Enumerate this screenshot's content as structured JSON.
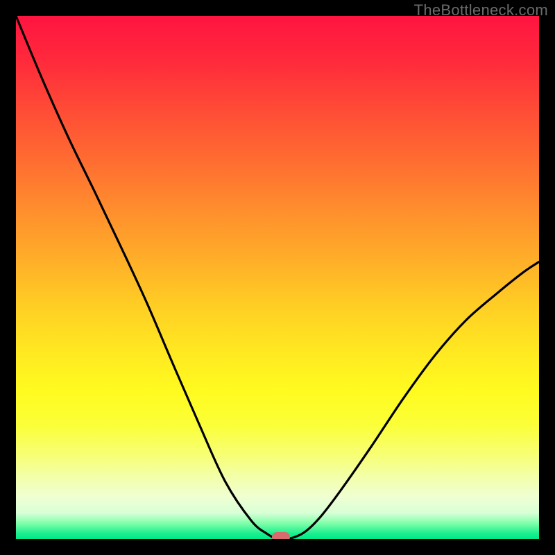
{
  "watermark": "TheBottleneck.com",
  "chart_data": {
    "type": "line",
    "title": "",
    "xlabel": "",
    "ylabel": "",
    "x": [
      0.0,
      0.05,
      0.1,
      0.15,
      0.2,
      0.25,
      0.3,
      0.35,
      0.4,
      0.45,
      0.48,
      0.5,
      0.52,
      0.55,
      0.58,
      0.62,
      0.68,
      0.74,
      0.8,
      0.86,
      0.92,
      0.97,
      1.0
    ],
    "values": [
      1.0,
      0.88,
      0.768,
      0.665,
      0.56,
      0.452,
      0.335,
      0.22,
      0.11,
      0.035,
      0.01,
      0.0,
      0.0,
      0.012,
      0.04,
      0.092,
      0.178,
      0.268,
      0.35,
      0.418,
      0.47,
      0.51,
      0.53
    ],
    "xlim": [
      0,
      1
    ],
    "ylim": [
      0,
      1
    ],
    "marker": {
      "x": 0.506,
      "y": 0.0
    },
    "background_gradient": {
      "type": "vertical",
      "stops": [
        {
          "pos": 0.0,
          "color": "#ff1440"
        },
        {
          "pos": 0.5,
          "color": "#ffb028"
        },
        {
          "pos": 0.78,
          "color": "#fbff37"
        },
        {
          "pos": 1.0,
          "color": "#00e987"
        }
      ]
    }
  }
}
